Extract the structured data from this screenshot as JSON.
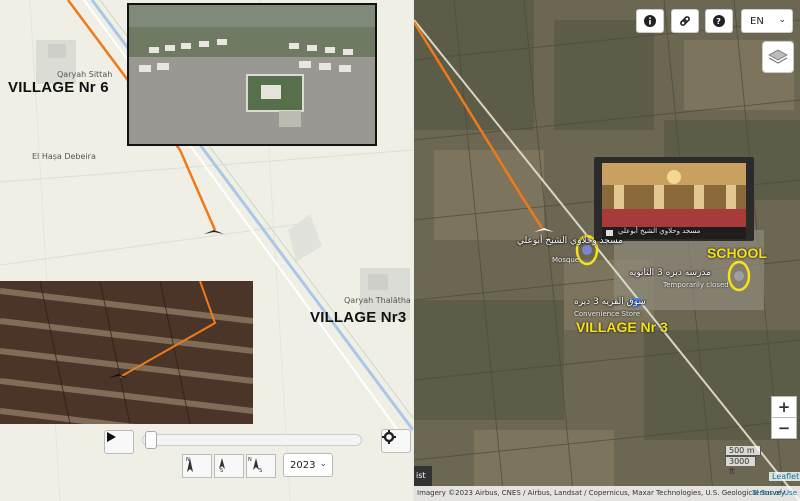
{
  "left_map": {
    "labels": {
      "qaryah_sittah": "Qaryah Sittah",
      "village_6": "VILLAGE Nr 6",
      "el_hasa": "El Haṣa Debeira",
      "qaryah_thalatha": "Qaryah Thalātha",
      "village_3": "VILLAGE Nr3"
    }
  },
  "player": {
    "year": "2023",
    "compass_labels": {
      "north": "N",
      "south": "S",
      "ns": "N S"
    }
  },
  "right_map": {
    "language": "EN",
    "pois": {
      "mosque_name": "مسجد وحلاوي الشيخ أبوعلي",
      "mosque_type": "Mosque",
      "school_name": "مدرسه ديره 3 الثانويه",
      "school_status": "Temporarily closed",
      "store_name": "سوق القريه 3 ديره",
      "store_type": "Convenience Store",
      "photo_caption": "مسجد وحلاوي الشيخ أبوعلي"
    },
    "annotations": {
      "school": "SCHOOL",
      "village_3": "VILLAGE Nr 3"
    },
    "zoom_in": "+",
    "zoom_out": "−",
    "scale": {
      "metric": "500 m",
      "imperial": "3000 ft"
    },
    "leaflet": "Leaflet",
    "attribution": "Imagery ©2023 Airbus, CNES / Airbus, Landsat / Copernicus, Maxar Technologies, U.S. Geological Survey",
    "terms": "Terms of Use",
    "list_tab": "ist"
  },
  "colors": {
    "route": "#f07a1a",
    "highlight": "#f5e21a",
    "canal": "#a9c8e8"
  }
}
